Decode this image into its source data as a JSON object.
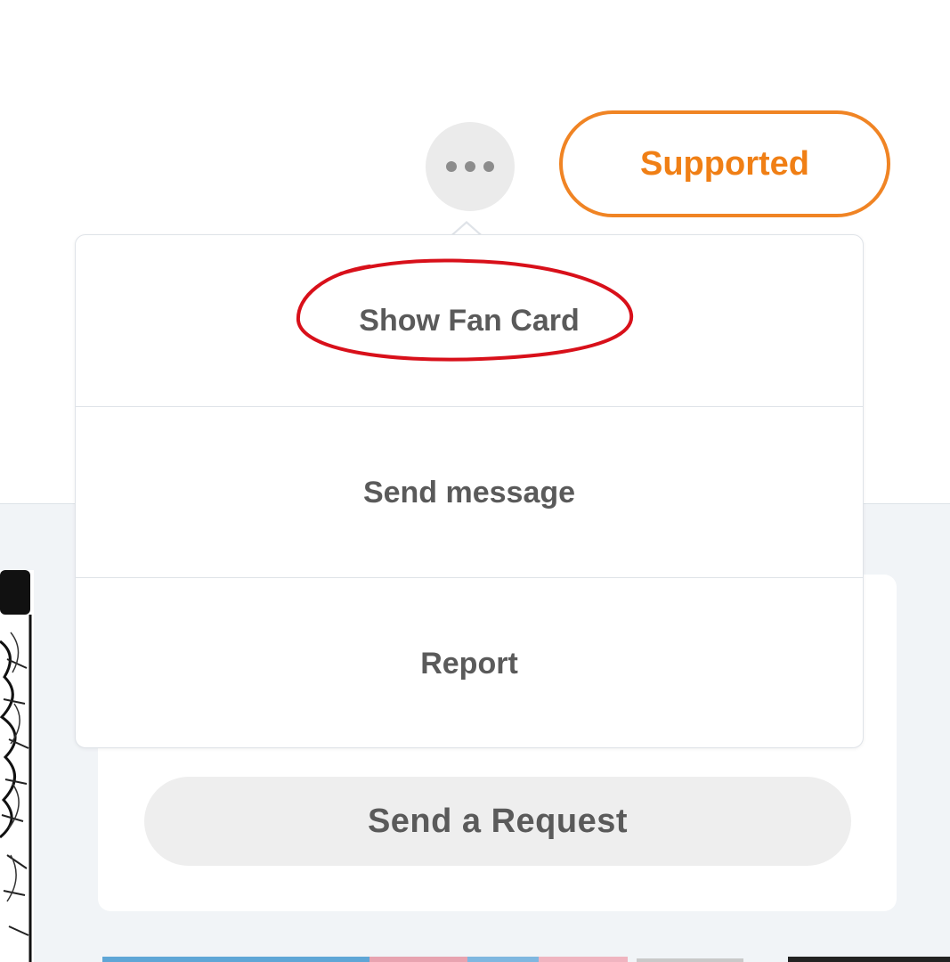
{
  "header": {
    "more_button_icon": "more-horizontal-icon",
    "supported_label": "Supported"
  },
  "menu": {
    "items": [
      {
        "label": "Show Fan Card"
      },
      {
        "label": "Send message"
      },
      {
        "label": "Report"
      }
    ]
  },
  "card": {
    "request_label": "Send a Request"
  },
  "colors": {
    "accent": "#f08424",
    "annotation": "#d8101a",
    "menu_text": "#5a5a5a",
    "lower_background": "#f1f4f7"
  }
}
